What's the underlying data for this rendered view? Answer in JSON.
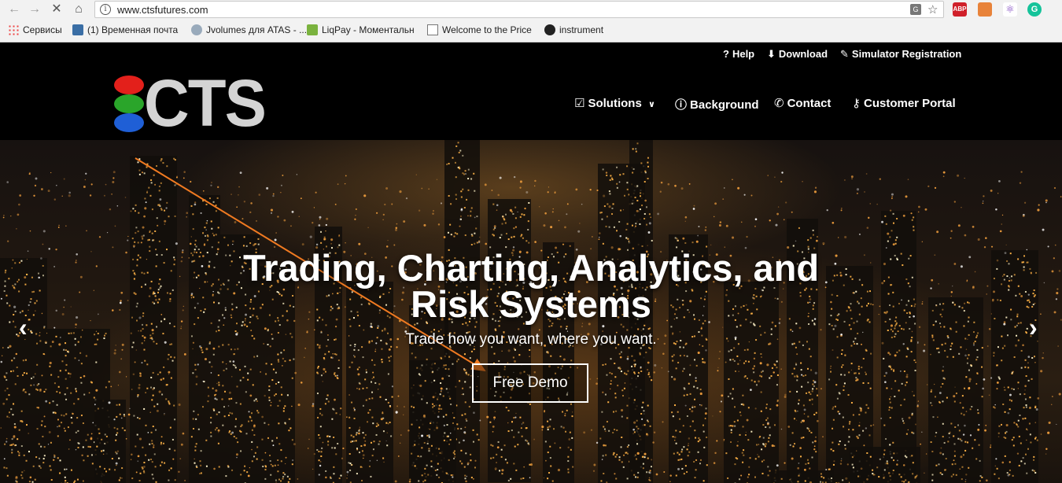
{
  "browser": {
    "url": "www.ctsfutures.com",
    "bookmarks": [
      {
        "label": "Сервисы",
        "icon": "apps-grid-icon"
      },
      {
        "label": "(1) Временная почта",
        "icon": "mail-icon"
      },
      {
        "label": "Jvolumes для ATAS - ...",
        "icon": "globe-icon"
      },
      {
        "label": "LiqPay - Моментальн",
        "icon": "liqpay-icon"
      },
      {
        "label": "Welcome to the Price",
        "icon": "page-icon"
      },
      {
        "label": "instrument",
        "icon": "instrument-icon"
      }
    ],
    "extensions": [
      "ABP"
    ]
  },
  "site": {
    "logo_text": "CTS",
    "logo_colors": [
      "#e3201b",
      "#2aa52a",
      "#1f5fd6"
    ],
    "utility_nav": [
      {
        "label": "Help",
        "icon": "question-icon"
      },
      {
        "label": "Download",
        "icon": "download-icon"
      },
      {
        "label": "Simulator Registration",
        "icon": "pencil-icon"
      }
    ],
    "main_nav": [
      {
        "label": "Solutions",
        "icon": "checkbox-icon"
      },
      {
        "label": "Background",
        "icon": "info-icon"
      },
      {
        "label": "Contact",
        "icon": "phone-icon"
      },
      {
        "label": "Customer Portal",
        "icon": "key-icon"
      }
    ]
  },
  "hero": {
    "headline_line1": "Trading, Charting, Analytics, and",
    "headline_line2": "Risk Systems",
    "subheadline": "Trade how you want, where you want.",
    "cta_label": "Free Demo",
    "annotation_color": "#f07a21"
  }
}
